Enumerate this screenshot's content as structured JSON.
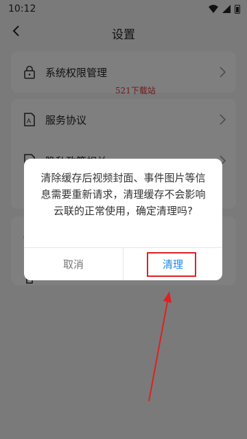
{
  "statusbar": {
    "time": "10:12"
  },
  "header": {
    "title": "设置",
    "back_icon": "back-arrow-icon"
  },
  "watermark": "521下载站",
  "settings": {
    "group1": [
      {
        "label": "系统权限管理",
        "icon": "lock-icon"
      }
    ],
    "group2": [
      {
        "label": "服务协议",
        "icon": "document-icon"
      },
      {
        "label": "隐私政策相关",
        "icon": "document-lines-icon"
      }
    ]
  },
  "dialog": {
    "message": "清除缓存后视频封面、事件图片等信息需要重新请求，清理缓存不会影响云联的正常使用，确定清理吗?",
    "cancel_label": "取消",
    "confirm_label": "清理"
  },
  "colors": {
    "accent": "#1e88e5",
    "annotation": "#e02020",
    "overlay": "rgba(0,0,0,0.5)"
  }
}
